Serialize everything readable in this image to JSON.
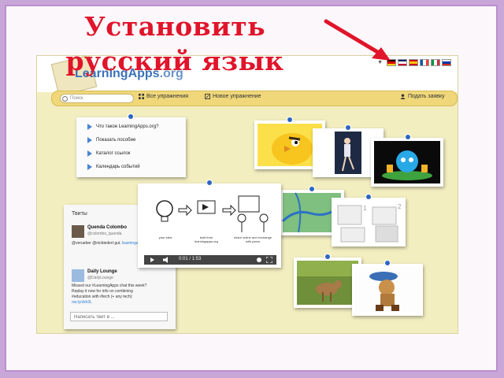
{
  "slide": {
    "title": "Установить русский язык"
  },
  "site": {
    "logo_text_main": "LearningApps",
    "logo_text_suffix": ".org",
    "languages": [
      {
        "name": "de",
        "colors": [
          "#000000",
          "#dd0000",
          "#ffce00"
        ],
        "dir": "h"
      },
      {
        "name": "en",
        "colors": [
          "#012169",
          "#ffffff",
          "#c8102e"
        ],
        "dir": "h"
      },
      {
        "name": "es",
        "colors": [
          "#c60b1e",
          "#ffc400",
          "#c60b1e"
        ],
        "dir": "h"
      },
      {
        "name": "fr",
        "colors": [
          "#0055a4",
          "#ffffff",
          "#ef4135"
        ],
        "dir": "v"
      },
      {
        "name": "it",
        "colors": [
          "#009246",
          "#ffffff",
          "#ce2b37"
        ],
        "dir": "v"
      },
      {
        "name": "ru",
        "colors": [
          "#ffffff",
          "#0039a6",
          "#d52b1e"
        ],
        "dir": "h"
      }
    ]
  },
  "toolbar": {
    "search_placeholder": "Поиск",
    "all_exercises": "Все упражнения",
    "new_exercise": "Новое упражнение",
    "submit_request": "Подать заявку"
  },
  "menu": {
    "items": [
      "Что такое LearningApps.org?",
      "Показать пособие",
      "Каталог ссылок",
      "Календарь событий"
    ]
  },
  "twitter": {
    "title": "Твиты",
    "tweet1_name": "Quenda Colombo",
    "tweet1_handle": "@colombo_quenda",
    "tweet1_text": "@verueber @nicbiedert gut.",
    "tweet1_link": "learningapps.org",
    "tweet2_name": "Daily Lounge",
    "tweet2_handle": "@DailyLounge",
    "tweet2_text": "Missed our #LearningApps chat this week? Replay it now for info on combining #education with #tech (+ any tech): ",
    "tweet2_link": "ow.ly/zkh3L",
    "input_placeholder": "Написать твит в ..."
  },
  "video": {
    "label1": "your idea",
    "label2": "built from learningapps.org",
    "label3": "share online and exchange with peers",
    "time": "0:01 / 1:53"
  },
  "colors": {
    "title_red": "#e0142a",
    "arrow_red": "#e0142a",
    "pin_blue": "#2c66c2",
    "toolbar_yellow": "#efd77a",
    "board_yellow": "#f3eec0"
  }
}
